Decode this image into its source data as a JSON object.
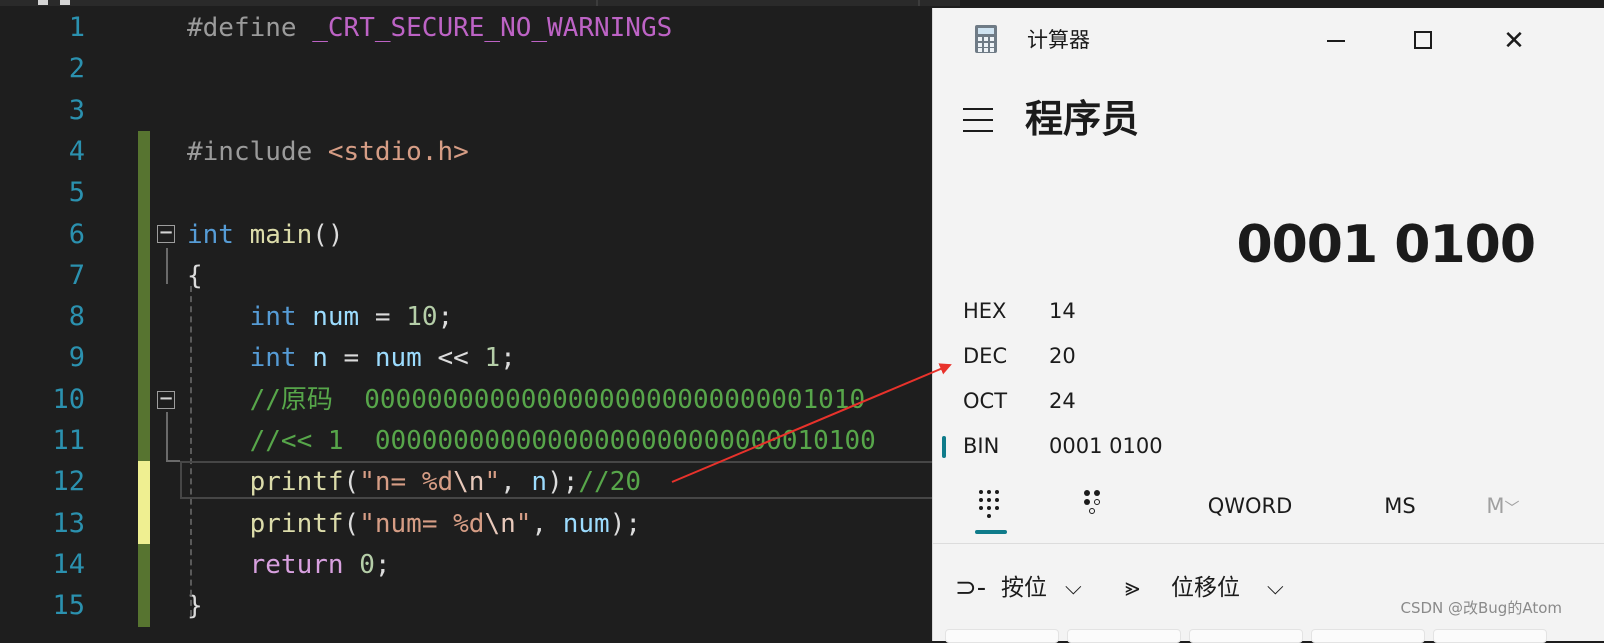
{
  "editor": {
    "lines": [
      {
        "n": "1",
        "parts": [
          [
            "pp",
            "#define "
          ],
          [
            "mac",
            "_CRT_SECURE_NO_WARNINGS"
          ]
        ]
      },
      {
        "n": "2",
        "parts": []
      },
      {
        "n": "3",
        "parts": []
      },
      {
        "n": "4",
        "parts": [
          [
            "pp",
            "#include "
          ],
          [
            "str",
            "<stdio.h>"
          ]
        ]
      },
      {
        "n": "5",
        "parts": []
      },
      {
        "n": "6",
        "parts": [
          [
            "kw",
            "int"
          ],
          [
            "txt",
            " "
          ],
          [
            "fn",
            "main"
          ],
          [
            "txt",
            "()"
          ]
        ]
      },
      {
        "n": "7",
        "parts": [
          [
            "txt",
            "{"
          ]
        ]
      },
      {
        "n": "8",
        "parts": [
          [
            "txt",
            "    "
          ],
          [
            "kw",
            "int"
          ],
          [
            "txt",
            " "
          ],
          [
            "var",
            "num"
          ],
          [
            "txt",
            " = "
          ],
          [
            "num",
            "10"
          ],
          [
            "txt",
            ";"
          ]
        ]
      },
      {
        "n": "9",
        "parts": [
          [
            "txt",
            "    "
          ],
          [
            "kw",
            "int"
          ],
          [
            "txt",
            " "
          ],
          [
            "var",
            "n"
          ],
          [
            "txt",
            " = "
          ],
          [
            "var",
            "num"
          ],
          [
            "txt",
            " << "
          ],
          [
            "num",
            "1"
          ],
          [
            "txt",
            ";"
          ]
        ]
      },
      {
        "n": "10",
        "parts": [
          [
            "txt",
            "    "
          ],
          [
            "cmt",
            "//原码  00000000000000000000000000001010"
          ]
        ]
      },
      {
        "n": "11",
        "parts": [
          [
            "txt",
            "    "
          ],
          [
            "cmt",
            "//<< 1  00000000000000000000000000010100"
          ]
        ]
      },
      {
        "n": "12",
        "parts": [
          [
            "txt",
            "    "
          ],
          [
            "fn",
            "printf"
          ],
          [
            "txt",
            "("
          ],
          [
            "str",
            "\"n= %d"
          ],
          [
            "esc",
            "\\n"
          ],
          [
            "str",
            "\""
          ],
          [
            "txt",
            ", "
          ],
          [
            "var",
            "n"
          ],
          [
            "txt",
            ");"
          ],
          [
            "cmt",
            "//20"
          ]
        ]
      },
      {
        "n": "13",
        "parts": [
          [
            "txt",
            "    "
          ],
          [
            "fn",
            "printf"
          ],
          [
            "txt",
            "("
          ],
          [
            "str",
            "\"num= %d"
          ],
          [
            "esc",
            "\\n"
          ],
          [
            "str",
            "\""
          ],
          [
            "txt",
            ", "
          ],
          [
            "var",
            "num"
          ],
          [
            "txt",
            ");"
          ]
        ]
      },
      {
        "n": "14",
        "parts": [
          [
            "txt",
            "    "
          ],
          [
            "kw2",
            "return"
          ],
          [
            "txt",
            " "
          ],
          [
            "num",
            "0"
          ],
          [
            "txt",
            ";"
          ]
        ]
      },
      {
        "n": "15",
        "parts": [
          [
            "txt",
            "}"
          ]
        ]
      }
    ],
    "fold_glyph": "−"
  },
  "calculator": {
    "window_title": "计算器",
    "close_glyph": "✕",
    "mode_title": "程序员",
    "result": "0001 0100",
    "radix": [
      {
        "label": "HEX",
        "value": "14",
        "selected": false
      },
      {
        "label": "DEC",
        "value": "20",
        "selected": false
      },
      {
        "label": "OCT",
        "value": "24",
        "selected": false
      },
      {
        "label": "BIN",
        "value": "0001 0100",
        "selected": true
      }
    ],
    "word_size": "QWORD",
    "memory_store": "MS",
    "memory_recall": "M",
    "memory_chevron": "﹀",
    "bitwise_label": "按位",
    "bitwise_icon": "⊃-",
    "shift_label": "位移位",
    "shift_icon": "⪢",
    "chevron": "⌵",
    "accent_color": "#0f7b8a"
  },
  "watermark": "CSDN @改Bug的Atom"
}
